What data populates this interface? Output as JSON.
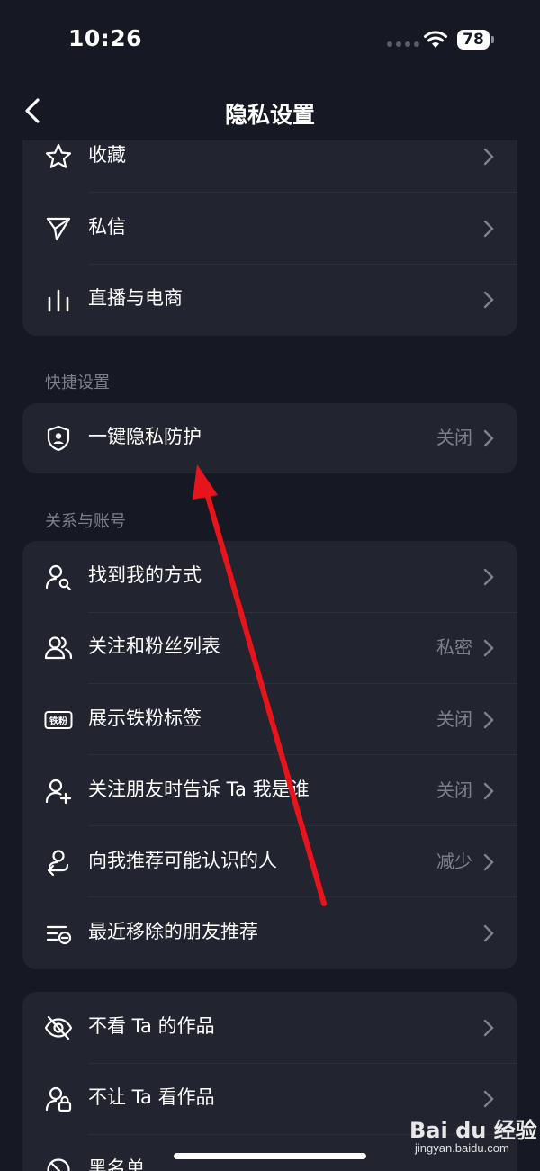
{
  "status": {
    "time": "10:26",
    "battery": "78"
  },
  "nav": {
    "title": "隐私设置"
  },
  "card1": [
    {
      "label": "收藏"
    },
    {
      "label": "私信"
    },
    {
      "label": "直播与电商"
    }
  ],
  "sections": {
    "quick": "快捷设置",
    "relations": "关系与账号"
  },
  "quick": {
    "label": "一键隐私防护",
    "value": "关闭"
  },
  "relations": [
    {
      "label": "找到我的方式",
      "value": ""
    },
    {
      "label": "关注和粉丝列表",
      "value": "私密"
    },
    {
      "label": "展示铁粉标签",
      "value": "关闭",
      "badge": "铁粉"
    },
    {
      "label": "关注朋友时告诉 Ta 我是谁",
      "value": "关闭"
    },
    {
      "label": "向我推荐可能认识的人",
      "value": "减少"
    },
    {
      "label": "最近移除的朋友推荐",
      "value": ""
    }
  ],
  "card4": [
    {
      "label": "不看 Ta 的作品"
    },
    {
      "label": "不让 Ta 看作品"
    },
    {
      "label": "黑名单"
    }
  ],
  "watermark": {
    "logo": "Bai du 经验",
    "url": "jingyan.baidu.com"
  },
  "colors": {
    "background": "#161823",
    "card": "#22242f",
    "annotation_arrow": "#e8141c"
  }
}
